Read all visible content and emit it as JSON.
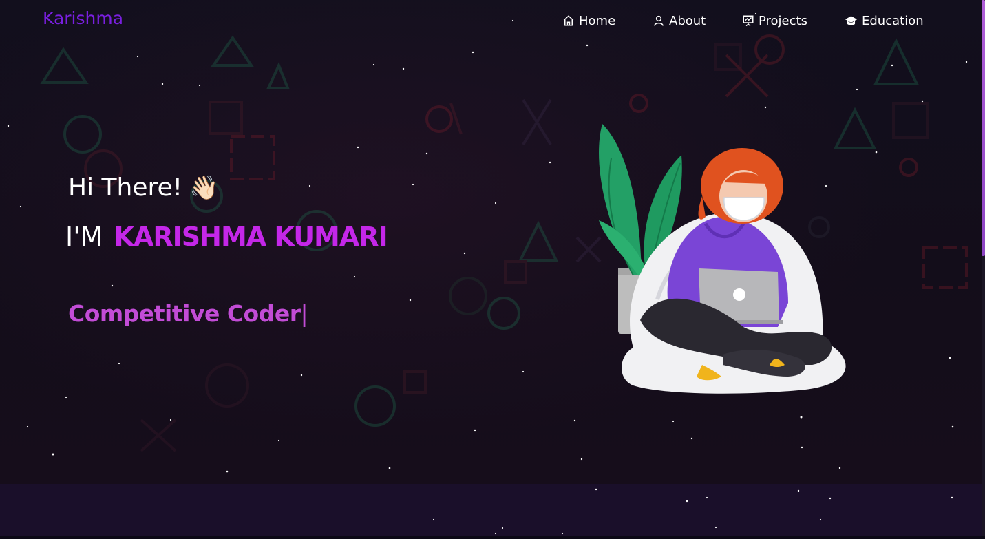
{
  "brand": {
    "logo_text": "Karishma"
  },
  "nav": {
    "items": [
      {
        "label": "Home",
        "icon": "home-icon"
      },
      {
        "label": "About",
        "icon": "user-icon"
      },
      {
        "label": "Projects",
        "icon": "presentation-icon"
      },
      {
        "label": "Education",
        "icon": "graduation-cap-icon"
      }
    ]
  },
  "hero": {
    "greeting": "Hi There!",
    "wave_emoji": "👋🏻",
    "intro_prefix": "I'M",
    "name": "KARISHMA KUMARI",
    "role": "Competitive Coder",
    "illustration": "girl-with-laptop-illustration"
  },
  "colors": {
    "brand_purple": "#7a1fe0",
    "name_magenta": "#c427e8",
    "role_purple": "#c24cd6",
    "hero_bg": "#120f1d",
    "section_bg": "#1a0f2a"
  }
}
